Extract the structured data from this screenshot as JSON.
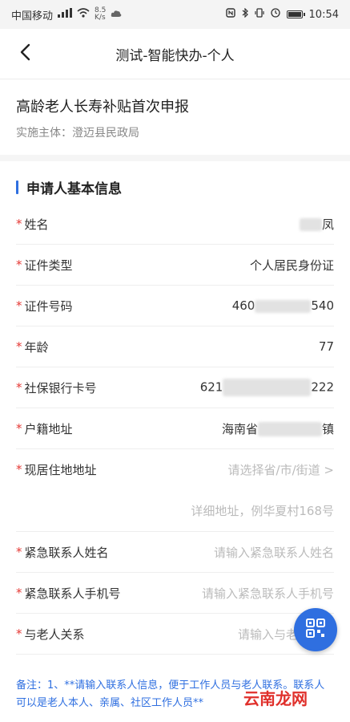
{
  "status_bar": {
    "carrier": "中国移动",
    "net_speed_value": "8.5",
    "net_speed_unit": "K/s",
    "time": "10:54"
  },
  "nav": {
    "title": "测试-智能快办-个人"
  },
  "service": {
    "title": "高龄老人长寿补贴首次申报",
    "subtitle": "实施主体：澄迈县民政局"
  },
  "section": {
    "title": "申请人基本信息"
  },
  "fields": {
    "name": {
      "label": "姓名",
      "value_suffix": "凤"
    },
    "id_type": {
      "label": "证件类型",
      "value": "个人居民身份证"
    },
    "id_number": {
      "label": "证件号码",
      "value_prefix": "460",
      "value_suffix": "540"
    },
    "age": {
      "label": "年龄",
      "value": "77"
    },
    "bank_card": {
      "label": "社保银行卡号",
      "value_prefix": "621",
      "value_suffix": "222"
    },
    "household": {
      "label": "户籍地址",
      "value_prefix": "海南省",
      "value_suffix": "镇"
    },
    "residence": {
      "label": "现居住地地址",
      "placeholder": "请选择省/市/街道 >",
      "detail_placeholder": "详细地址，例华夏村168号"
    },
    "emergency_name": {
      "label": "紧急联系人姓名",
      "placeholder": "请输入紧急联系人姓名"
    },
    "emergency_phone": {
      "label": "紧急联系人手机号",
      "placeholder": "请输入紧急联系人手机号"
    },
    "relation": {
      "label": "与老人关系",
      "placeholder": "请输入与老人关系"
    }
  },
  "note": {
    "text": "备注：1、**请输入联系人信息，便于工作人员与老人联系。联系人可以是老人本人、亲属、社区工作人员**"
  },
  "watermark": {
    "text": "云南龙网"
  },
  "colors": {
    "accent": "#2f6fe0",
    "required": "#e53935",
    "placeholder": "#bbbbbb"
  }
}
